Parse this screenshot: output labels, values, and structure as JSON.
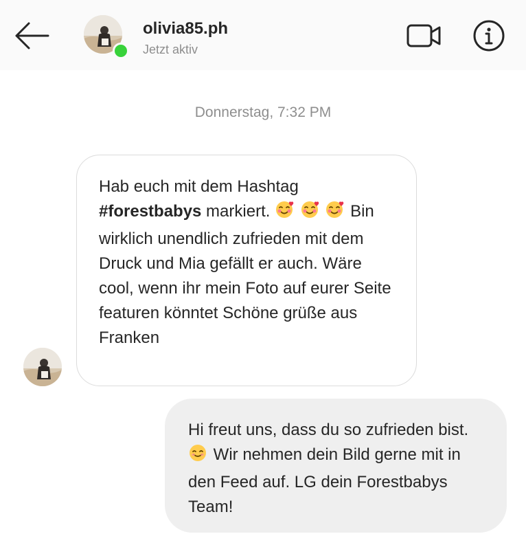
{
  "header": {
    "username": "olivia85.ph",
    "status": "Jetzt aktiv"
  },
  "thread": {
    "timestamp": "Donnerstag, 7:32 PM",
    "incoming": {
      "text_before": "Hab euch mit dem Hashtag ",
      "hashtag": "#forestbabys",
      "text_mid": " markiert. ",
      "emoji": "🥰",
      "text_after": " Bin wirklich unendlich zufrieden mit dem Druck und Mia gefällt er auch. Wäre cool, wenn ihr mein Foto auf eurer Seite featuren könntet Schöne grüße aus Franken"
    },
    "outgoing": {
      "text_before": "Hi freut uns, dass du so zufrieden bist.",
      "emoji": "☺️",
      "text_after": " Wir nehmen dein Bild gerne mit in den Feed auf. LG dein Forestbabys Team!"
    }
  },
  "colors": {
    "header_bg": "#fafafa",
    "online": "#38d23a",
    "secondary_text": "#8e8e8e",
    "outgoing_bubble": "#efefef",
    "incoming_border": "#dbdbdb"
  },
  "icons": [
    "back-arrow-icon",
    "video-call-icon",
    "info-icon",
    "smiling-face-with-hearts-emoji",
    "smiling-face-emoji"
  ]
}
